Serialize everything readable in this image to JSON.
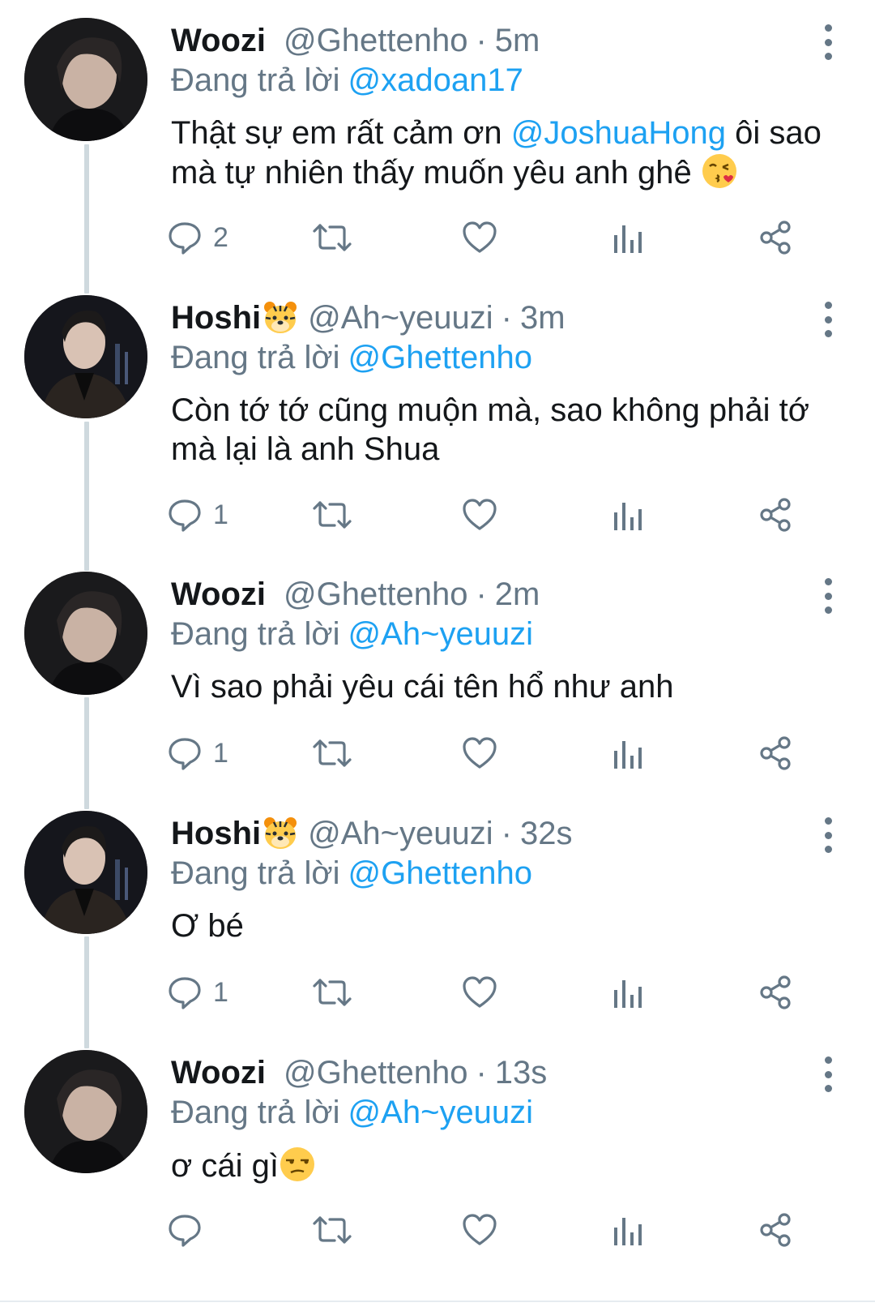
{
  "colors": {
    "link": "#1da1f2",
    "secondary_text": "#657786",
    "primary_text": "#14171a",
    "thread_line": "#cfd9de"
  },
  "reply_prefix": "Đang trả lời",
  "tweets": [
    {
      "name": "Woozi",
      "badge": "",
      "handle": "@Ghettenho",
      "separator": "·",
      "time": "5m",
      "reply_to": "@xadoan17",
      "text_parts": [
        "Thật sự em rất cảm ơn ",
        "@JoshuaHong",
        " ôi sao mà tự nhiên thấy muốn yêu anh ghê "
      ],
      "emoji": "face-blowing-a-kiss",
      "reply_count": "2",
      "avatar": "woozi"
    },
    {
      "name": "Hoshi",
      "badge": "tiger-face",
      "handle": "@Ah~yeuuzi",
      "separator": "·",
      "time": "3m",
      "reply_to": "@Ghettenho",
      "text_parts": [
        "Còn tớ tớ cũng muộn mà, sao không phải tớ mà lại là anh Shua"
      ],
      "reply_count": "1",
      "avatar": "hoshi"
    },
    {
      "name": "Woozi",
      "badge": "",
      "handle": "@Ghettenho",
      "separator": "·",
      "time": "2m",
      "reply_to": "@Ah~yeuuzi",
      "text_parts": [
        "Vì sao phải yêu cái tên hổ như anh"
      ],
      "reply_count": "1",
      "avatar": "woozi"
    },
    {
      "name": "Hoshi",
      "badge": "tiger-face",
      "handle": "@Ah~yeuuzi",
      "separator": "·",
      "time": "32s",
      "reply_to": "@Ghettenho",
      "text_parts": [
        "Ơ bé"
      ],
      "reply_count": "1",
      "avatar": "hoshi"
    },
    {
      "name": "Woozi",
      "badge": "",
      "handle": "@Ghettenho",
      "separator": "·",
      "time": "13s",
      "reply_to": "@Ah~yeuuzi",
      "text_parts": [
        "ơ cái gì"
      ],
      "emoji": "unamused-face",
      "reply_count": "",
      "avatar": "woozi"
    }
  ],
  "icons": {
    "reply": "reply-icon",
    "retweet": "retweet-icon",
    "like": "heart-icon",
    "analytics": "analytics-icon",
    "share": "share-icon",
    "more": "more-vertical-icon"
  }
}
